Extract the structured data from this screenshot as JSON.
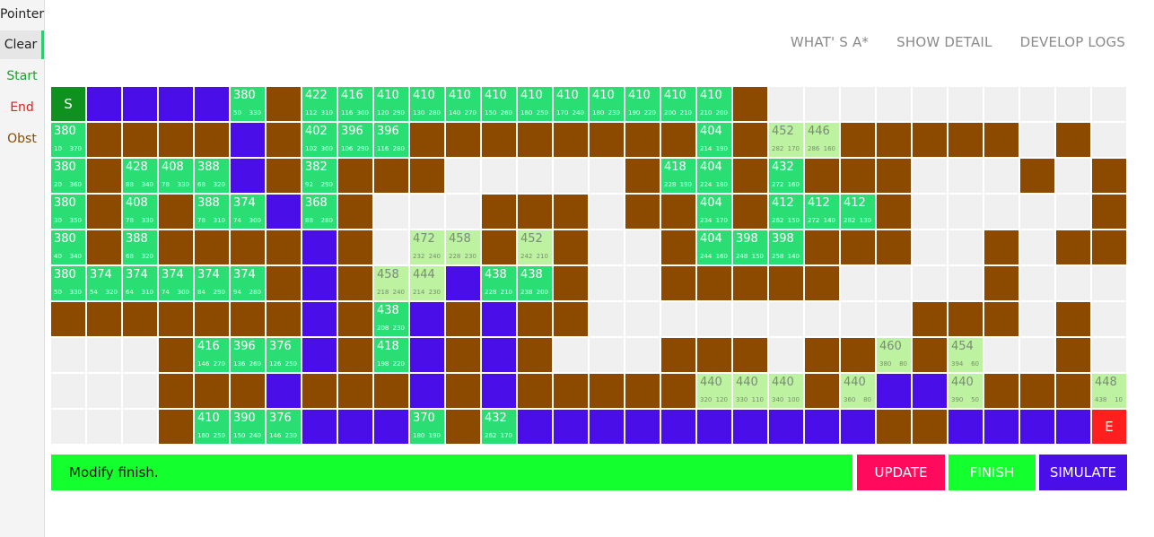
{
  "sidebar": {
    "tools": [
      {
        "label": "Pointer",
        "color": "#222222",
        "active": false
      },
      {
        "label": "Clear",
        "color": "#222222",
        "active": true
      },
      {
        "label": "Start",
        "color": "#1e9e2c",
        "active": false
      },
      {
        "label": "End",
        "color": "#e0201d",
        "active": false
      },
      {
        "label": "Obst",
        "color": "#8b4a00",
        "active": false
      }
    ]
  },
  "nav": {
    "whats_label": "WHAT' S A*",
    "detail_label": "SHOW DETAIL",
    "logs_label": "DEVELOP LOGS"
  },
  "colors": {
    "wall": "#8b4a00",
    "closed": "#4a0ee8",
    "open": "#2bde73",
    "frontier": "#bdf3a0",
    "start": "#0f9120",
    "end": "#ff1f1f",
    "empty": "#f0f0f0"
  },
  "legend": {
    "s": "start",
    "e": "end",
    "w": "wall",
    "c": "closed",
    "o": "open-scored",
    "p": "frontier-scored",
    ".": "empty"
  },
  "grid": {
    "rows": [
      [
        [
          "s",
          "S"
        ],
        [
          "c"
        ],
        [
          "c"
        ],
        [
          "c"
        ],
        [
          "c"
        ],
        [
          "o",
          "380",
          "50",
          "330"
        ],
        [
          "w"
        ],
        [
          "o",
          "422",
          "112",
          "310"
        ],
        [
          "o",
          "416",
          "116",
          "300"
        ],
        [
          "o",
          "410",
          "120",
          "290"
        ],
        [
          "o",
          "410",
          "130",
          "280"
        ],
        [
          "o",
          "410",
          "140",
          "270"
        ],
        [
          "o",
          "410",
          "150",
          "260"
        ],
        [
          "o",
          "410",
          "160",
          "250"
        ],
        [
          "o",
          "410",
          "170",
          "240"
        ],
        [
          "o",
          "410",
          "180",
          "230"
        ],
        [
          "o",
          "410",
          "190",
          "220"
        ],
        [
          "o",
          "410",
          "200",
          "210"
        ],
        [
          "o",
          "410",
          "210",
          "200"
        ],
        [
          "w"
        ],
        [
          "."
        ],
        [
          "."
        ],
        [
          "."
        ],
        [
          "."
        ],
        [
          "."
        ],
        [
          "."
        ],
        [
          "."
        ],
        [
          "."
        ],
        [
          "."
        ],
        [
          "."
        ]
      ],
      [
        [
          "o",
          "380",
          "10",
          "370"
        ],
        [
          "w"
        ],
        [
          "w"
        ],
        [
          "w"
        ],
        [
          "w"
        ],
        [
          "c"
        ],
        [
          "w"
        ],
        [
          "o",
          "402",
          "102",
          "300"
        ],
        [
          "o",
          "396",
          "106",
          "290"
        ],
        [
          "o",
          "396",
          "116",
          "280"
        ],
        [
          "w"
        ],
        [
          "w"
        ],
        [
          "w"
        ],
        [
          "w"
        ],
        [
          "w"
        ],
        [
          "w"
        ],
        [
          "w"
        ],
        [
          "w"
        ],
        [
          "o",
          "404",
          "214",
          "190"
        ],
        [
          "w"
        ],
        [
          "p",
          "452",
          "282",
          "170"
        ],
        [
          "p",
          "446",
          "286",
          "160"
        ],
        [
          "w"
        ],
        [
          "w"
        ],
        [
          "w"
        ],
        [
          "w"
        ],
        [
          "w"
        ],
        [
          "."
        ],
        [
          "w"
        ],
        [
          "."
        ]
      ],
      [
        [
          "o",
          "380",
          "20",
          "360"
        ],
        [
          "w"
        ],
        [
          "o",
          "428",
          "88",
          "340"
        ],
        [
          "o",
          "408",
          "78",
          "330"
        ],
        [
          "o",
          "388",
          "68",
          "320"
        ],
        [
          "c"
        ],
        [
          "w"
        ],
        [
          "o",
          "382",
          "92",
          "290"
        ],
        [
          "w"
        ],
        [
          "w"
        ],
        [
          "w"
        ],
        [
          "."
        ],
        [
          "."
        ],
        [
          "."
        ],
        [
          "."
        ],
        [
          "."
        ],
        [
          "w"
        ],
        [
          "o",
          "418",
          "228",
          "190"
        ],
        [
          "o",
          "404",
          "224",
          "180"
        ],
        [
          "w"
        ],
        [
          "o",
          "432",
          "272",
          "160"
        ],
        [
          "w"
        ],
        [
          "w"
        ],
        [
          "w"
        ],
        [
          "."
        ],
        [
          "."
        ],
        [
          "."
        ],
        [
          "w"
        ],
        [
          "."
        ],
        [
          "w"
        ]
      ],
      [
        [
          "o",
          "380",
          "30",
          "350"
        ],
        [
          "w"
        ],
        [
          "o",
          "408",
          "78",
          "330"
        ],
        [
          "w"
        ],
        [
          "o",
          "388",
          "78",
          "310"
        ],
        [
          "o",
          "374",
          "74",
          "300"
        ],
        [
          "c"
        ],
        [
          "o",
          "368",
          "88",
          "280"
        ],
        [
          "w"
        ],
        [
          "."
        ],
        [
          "."
        ],
        [
          "."
        ],
        [
          "w"
        ],
        [
          "w"
        ],
        [
          "w"
        ],
        [
          "."
        ],
        [
          "w"
        ],
        [
          "w"
        ],
        [
          "o",
          "404",
          "234",
          "170"
        ],
        [
          "w"
        ],
        [
          "o",
          "412",
          "262",
          "150"
        ],
        [
          "o",
          "412",
          "272",
          "140"
        ],
        [
          "o",
          "412",
          "282",
          "130"
        ],
        [
          "w"
        ],
        [
          "."
        ],
        [
          "."
        ],
        [
          "."
        ],
        [
          "."
        ],
        [
          "."
        ],
        [
          "w"
        ]
      ],
      [
        [
          "o",
          "380",
          "40",
          "340"
        ],
        [
          "w"
        ],
        [
          "o",
          "388",
          "68",
          "320"
        ],
        [
          "w"
        ],
        [
          "w"
        ],
        [
          "w"
        ],
        [
          "w"
        ],
        [
          "c"
        ],
        [
          "w"
        ],
        [
          "."
        ],
        [
          "p",
          "472",
          "232",
          "240"
        ],
        [
          "p",
          "458",
          "228",
          "230"
        ],
        [
          "w"
        ],
        [
          "p",
          "452",
          "242",
          "210"
        ],
        [
          "w"
        ],
        [
          "."
        ],
        [
          "."
        ],
        [
          "w"
        ],
        [
          "o",
          "404",
          "244",
          "160"
        ],
        [
          "o",
          "398",
          "248",
          "150"
        ],
        [
          "o",
          "398",
          "258",
          "140"
        ],
        [
          "w"
        ],
        [
          "w"
        ],
        [
          "w"
        ],
        [
          "."
        ],
        [
          "."
        ],
        [
          "w"
        ],
        [
          "."
        ],
        [
          "w"
        ],
        [
          "w"
        ]
      ],
      [
        [
          "o",
          "380",
          "50",
          "330"
        ],
        [
          "o",
          "374",
          "54",
          "320"
        ],
        [
          "o",
          "374",
          "64",
          "310"
        ],
        [
          "o",
          "374",
          "74",
          "300"
        ],
        [
          "o",
          "374",
          "84",
          "290"
        ],
        [
          "o",
          "374",
          "94",
          "280"
        ],
        [
          "w"
        ],
        [
          "c"
        ],
        [
          "w"
        ],
        [
          "p",
          "458",
          "218",
          "240"
        ],
        [
          "p",
          "444",
          "214",
          "230"
        ],
        [
          "c"
        ],
        [
          "o",
          "438",
          "228",
          "210"
        ],
        [
          "o",
          "438",
          "238",
          "200"
        ],
        [
          "w"
        ],
        [
          "."
        ],
        [
          "."
        ],
        [
          "w"
        ],
        [
          "w"
        ],
        [
          "w"
        ],
        [
          "w"
        ],
        [
          "w"
        ],
        [
          "."
        ],
        [
          "."
        ],
        [
          "."
        ],
        [
          "."
        ],
        [
          "w"
        ],
        [
          "."
        ],
        [
          "."
        ],
        [
          "."
        ]
      ],
      [
        [
          "w"
        ],
        [
          "w"
        ],
        [
          "w"
        ],
        [
          "w"
        ],
        [
          "w"
        ],
        [
          "w"
        ],
        [
          "w"
        ],
        [
          "c"
        ],
        [
          "w"
        ],
        [
          "o",
          "438",
          "208",
          "230"
        ],
        [
          "c"
        ],
        [
          "w"
        ],
        [
          "c"
        ],
        [
          "w"
        ],
        [
          "w"
        ],
        [
          "."
        ],
        [
          "."
        ],
        [
          "."
        ],
        [
          "."
        ],
        [
          "."
        ],
        [
          "."
        ],
        [
          "."
        ],
        [
          "."
        ],
        [
          "."
        ],
        [
          "w"
        ],
        [
          "w"
        ],
        [
          "w"
        ],
        [
          "."
        ],
        [
          "w"
        ],
        [
          "."
        ]
      ],
      [
        [
          "."
        ],
        [
          "."
        ],
        [
          "."
        ],
        [
          "w"
        ],
        [
          "o",
          "416",
          "146",
          "270"
        ],
        [
          "o",
          "396",
          "136",
          "260"
        ],
        [
          "o",
          "376",
          "126",
          "250"
        ],
        [
          "c"
        ],
        [
          "w"
        ],
        [
          "o",
          "418",
          "198",
          "220"
        ],
        [
          "c"
        ],
        [
          "w"
        ],
        [
          "c"
        ],
        [
          "w"
        ],
        [
          "."
        ],
        [
          "."
        ],
        [
          "."
        ],
        [
          "w"
        ],
        [
          "w"
        ],
        [
          "w"
        ],
        [
          "."
        ],
        [
          "w"
        ],
        [
          "w"
        ],
        [
          "p",
          "460",
          "380",
          "80"
        ],
        [
          "w"
        ],
        [
          "p",
          "454",
          "394",
          "60"
        ],
        [
          "."
        ],
        [
          "."
        ],
        [
          "w"
        ],
        [
          "."
        ]
      ],
      [
        [
          "."
        ],
        [
          "."
        ],
        [
          "."
        ],
        [
          "w"
        ],
        [
          "w"
        ],
        [
          "w"
        ],
        [
          "c"
        ],
        [
          "w"
        ],
        [
          "w"
        ],
        [
          "w"
        ],
        [
          "c"
        ],
        [
          "w"
        ],
        [
          "c"
        ],
        [
          "w"
        ],
        [
          "w"
        ],
        [
          "w"
        ],
        [
          "w"
        ],
        [
          "w"
        ],
        [
          "p",
          "440",
          "320",
          "120"
        ],
        [
          "p",
          "440",
          "330",
          "110"
        ],
        [
          "p",
          "440",
          "340",
          "100"
        ],
        [
          "w"
        ],
        [
          "p",
          "440",
          "360",
          "80"
        ],
        [
          "c"
        ],
        [
          "c"
        ],
        [
          "p",
          "440",
          "390",
          "50"
        ],
        [
          "w"
        ],
        [
          "w"
        ],
        [
          "w"
        ],
        [
          "p",
          "448",
          "438",
          "10"
        ]
      ],
      [
        [
          "."
        ],
        [
          "."
        ],
        [
          "."
        ],
        [
          "w"
        ],
        [
          "o",
          "410",
          "160",
          "250"
        ],
        [
          "o",
          "390",
          "150",
          "240"
        ],
        [
          "o",
          "376",
          "146",
          "230"
        ],
        [
          "c"
        ],
        [
          "c"
        ],
        [
          "c"
        ],
        [
          "o",
          "370",
          "180",
          "190"
        ],
        [
          "w"
        ],
        [
          "o",
          "432",
          "262",
          "170"
        ],
        [
          "c"
        ],
        [
          "c"
        ],
        [
          "c"
        ],
        [
          "c"
        ],
        [
          "c"
        ],
        [
          "c"
        ],
        [
          "c"
        ],
        [
          "c"
        ],
        [
          "c"
        ],
        [
          "c"
        ],
        [
          "w"
        ],
        [
          "w"
        ],
        [
          "c"
        ],
        [
          "c"
        ],
        [
          "c"
        ],
        [
          "c"
        ],
        [
          "e",
          "E"
        ]
      ]
    ]
  },
  "status": {
    "message": "Modify finish.",
    "color": "#14ff2e"
  },
  "actions": {
    "update_label": "UPDATE",
    "finish_label": "FINISH",
    "simulate_label": "SIMULATE",
    "update_color": "#ff0a5c",
    "finish_color": "#14ff2e",
    "simulate_color": "#4a0ee8"
  }
}
